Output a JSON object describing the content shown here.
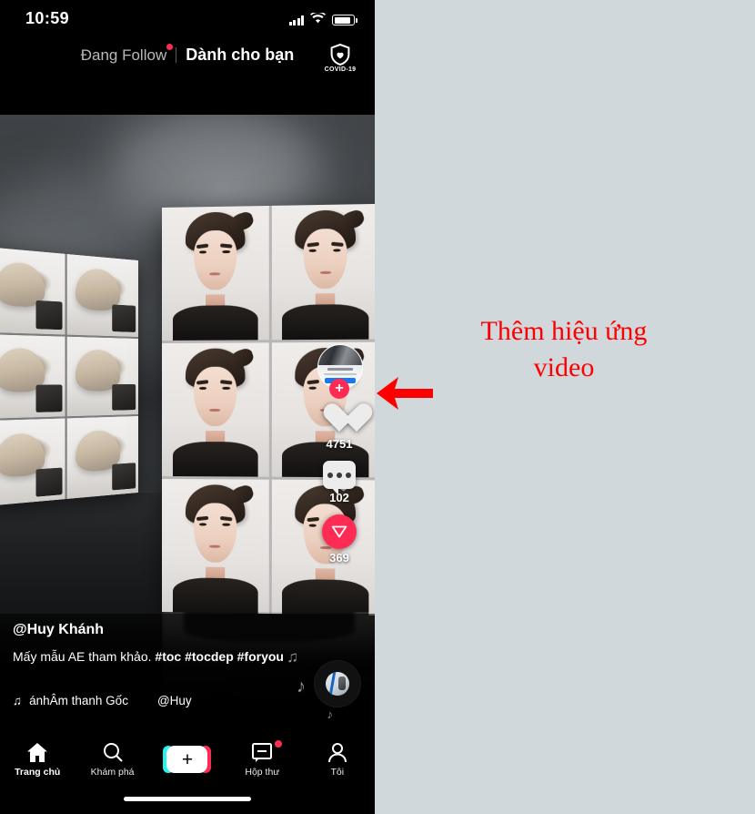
{
  "status_bar": {
    "time": "10:59",
    "signal_icon": "cellular-bars-icon",
    "wifi_icon": "wifi-icon",
    "battery_icon": "battery-icon"
  },
  "top_bar": {
    "tabs": [
      {
        "label": "Đang Follow",
        "active": false,
        "has_dot": true
      },
      {
        "label": "Dành cho bạn",
        "active": true,
        "has_dot": false
      }
    ],
    "covid_button": {
      "label": "COVID-19",
      "icon": "shield-heart-icon"
    }
  },
  "video": {
    "description": "Smoky dark studio with two photo grids of hairstyles",
    "panels": [
      {
        "name": "back-of-head-grid",
        "rows": 3,
        "cols": 2
      },
      {
        "name": "portrait-grid",
        "rows": 3,
        "cols": 2
      }
    ]
  },
  "action_rail": {
    "avatar": {
      "name": "avatar",
      "follow_label": "+"
    },
    "like": {
      "icon": "heart-icon",
      "count": "4751"
    },
    "comment": {
      "icon": "comment-bubble-icon",
      "count": "102"
    },
    "share": {
      "icon": "share-arrow-icon",
      "count": "369"
    }
  },
  "caption": {
    "username": "@Huy Khánh",
    "text_plain": "Mấy mẫu AE tham khảo. ",
    "hashtags": "#toc #tocdep #foryou",
    "music_icon": "music-note-icon",
    "music_title": "ánhÂm thanh Gốc",
    "music_author": "@Huy",
    "disc_icon": "vinyl-disc-icon",
    "note_glyph_1": "♫",
    "note_glyph_2": "♪",
    "note_glyph_3": "♪"
  },
  "bottom_nav": {
    "items": [
      {
        "label": "Trang chủ",
        "icon": "home-icon",
        "active": true,
        "has_dot": false
      },
      {
        "label": "Khám phá",
        "icon": "search-icon",
        "active": false,
        "has_dot": false
      },
      {
        "label": "",
        "icon": "create-plus-icon",
        "active": false,
        "has_dot": false,
        "plus": "+"
      },
      {
        "label": "Hộp thư",
        "icon": "inbox-message-icon",
        "active": false,
        "has_dot": true
      },
      {
        "label": "Tôi",
        "icon": "person-icon",
        "active": false,
        "has_dot": false
      }
    ]
  },
  "annotation": {
    "text_line_1": "Thêm hiệu ứng",
    "text_line_2": "video",
    "color": "#ff0000",
    "arrow_icon": "left-arrow-annotation"
  },
  "colors": {
    "page_background": "#d1d8dc",
    "accent_pink": "#fe2c55",
    "accent_cyan": "#25f4ee",
    "phone_background": "#000000"
  }
}
